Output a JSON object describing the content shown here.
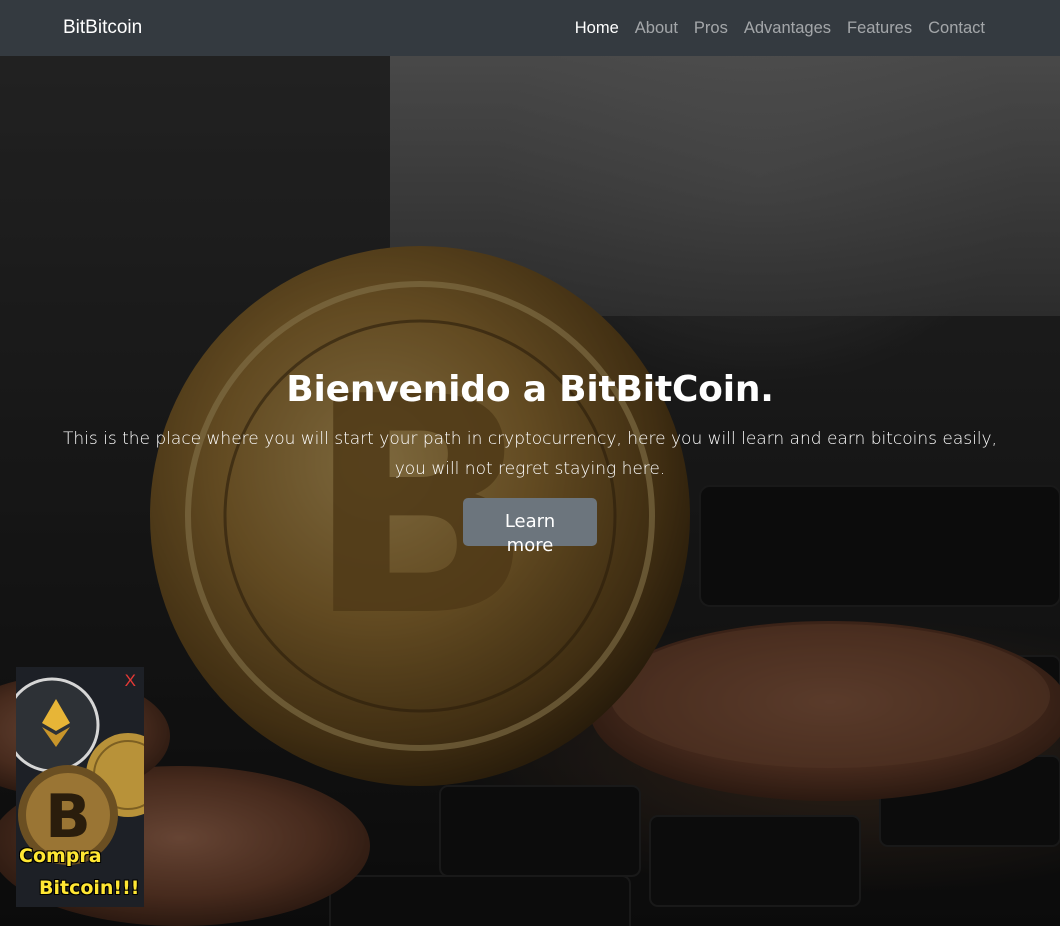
{
  "navbar": {
    "brand": "BitBitcoin",
    "links": [
      {
        "label": "Home",
        "active": true
      },
      {
        "label": "About",
        "active": false
      },
      {
        "label": "Pros",
        "active": false
      },
      {
        "label": "Advantages",
        "active": false
      },
      {
        "label": "Features",
        "active": false
      },
      {
        "label": "Contact",
        "active": false
      }
    ]
  },
  "hero": {
    "title": "Bienvenido a BitBitCoin.",
    "subtitle": "This is the place where you will start your path in cryptocurrency, here you will learn and earn bitcoins easily, you will not regret staying here.",
    "button_label": "Learn more",
    "background_icon": "bitcoin-coin-on-keyboard-image"
  },
  "ad": {
    "close_label": "X",
    "line1": "Compra",
    "line2": "Bitcoin!!!",
    "icons": [
      "ethereum-coin-icon",
      "ripple-coin-icon",
      "bitcoin-coin-icon"
    ]
  },
  "colors": {
    "navbar_bg": "#343a40",
    "button_bg": "#6c757d",
    "ad_text": "#ffe733",
    "ad_close": "#e53935"
  }
}
